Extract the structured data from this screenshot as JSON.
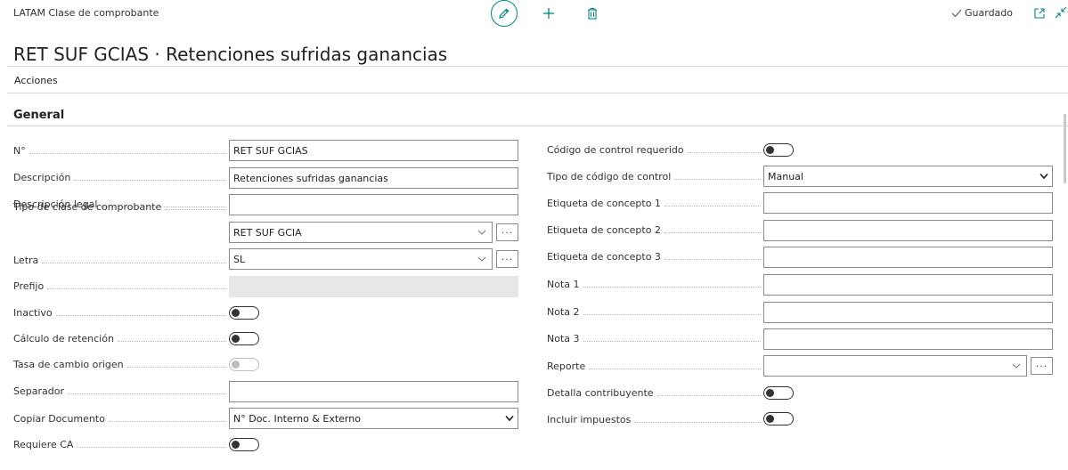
{
  "header": {
    "breadcrumb": "LATAM Clase de comprobante",
    "status": "Guardado",
    "title": "RET SUF GCIAS · Retenciones sufridas ganancias"
  },
  "menu": {
    "actions": "Acciones"
  },
  "section": {
    "title": "General"
  },
  "left": {
    "no": {
      "label": "N°",
      "value": "RET SUF GCIAS"
    },
    "descripcion": {
      "label": "Descripción",
      "value": "Retenciones sufridas ganancias"
    },
    "descripcion_legal": {
      "label": "Descripción legal",
      "value": ""
    },
    "tipo_clase": {
      "label": "Tipo de clase de comprobante",
      "value": "RET SUF GCIA"
    },
    "letra": {
      "label": "Letra",
      "value": "SL"
    },
    "prefijo": {
      "label": "Prefijo",
      "value": ""
    },
    "inactivo": {
      "label": "Inactivo",
      "checked": false
    },
    "calculo": {
      "label": "Cálculo de retención",
      "checked": false
    },
    "tasa": {
      "label": "Tasa de cambio origen",
      "checked": false,
      "disabled": true
    },
    "separador": {
      "label": "Separador",
      "value": ""
    },
    "copiar": {
      "label": "Copiar Documento",
      "value": "N° Doc. Interno & Externo"
    },
    "requiere_ca": {
      "label": "Requiere CA",
      "checked": false
    }
  },
  "right": {
    "codigo_control": {
      "label": "Código de control requerido",
      "checked": false
    },
    "tipo_codigo": {
      "label": "Tipo de código de control",
      "value": "Manual"
    },
    "etiqueta1": {
      "label": "Etiqueta de concepto 1",
      "value": ""
    },
    "etiqueta2": {
      "label": "Etiqueta de concepto 2",
      "value": ""
    },
    "etiqueta3": {
      "label": "Etiqueta de concepto 3",
      "value": ""
    },
    "nota1": {
      "label": "Nota 1",
      "value": ""
    },
    "nota2": {
      "label": "Nota 2",
      "value": ""
    },
    "nota3": {
      "label": "Nota 3",
      "value": ""
    },
    "reporte": {
      "label": "Reporte",
      "value": ""
    },
    "detalla": {
      "label": "Detalla contribuyente",
      "checked": false
    },
    "incluir": {
      "label": "Incluir impuestos",
      "checked": false
    }
  },
  "icons": {
    "edit": "pencil-icon",
    "add": "plus-icon",
    "delete": "trash-icon",
    "saved": "check-icon",
    "popout": "open-in-new-window-icon",
    "collapse": "collapse-icon",
    "dropdown": "chevron-down-icon",
    "lookup": "ellipsis-icon"
  },
  "colors": {
    "accent": "#00847d",
    "text": "#212121",
    "disabled_field": "#e6e7e8"
  }
}
